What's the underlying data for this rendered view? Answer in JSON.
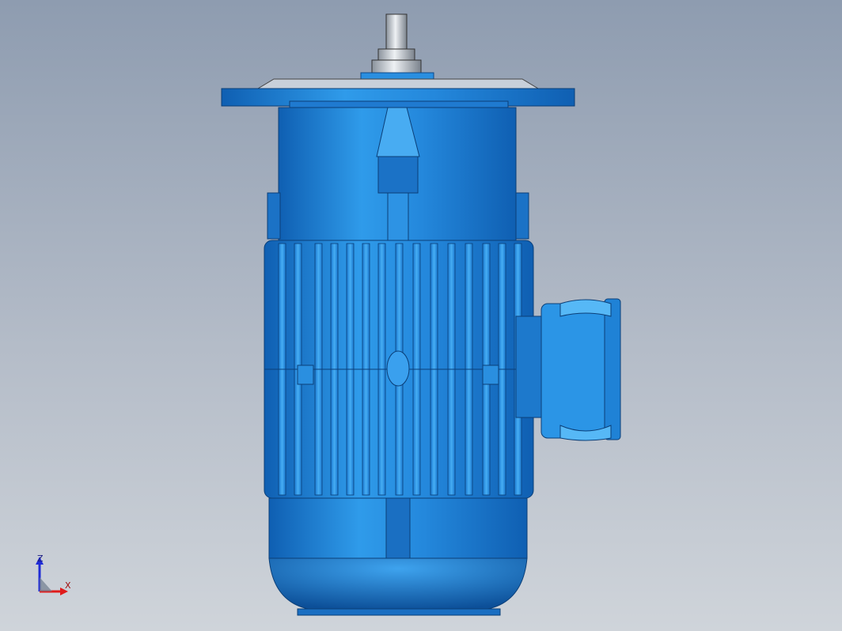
{
  "viewport": {
    "background_top": "#8e9cb0",
    "background_bottom": "#cfd4da"
  },
  "model": {
    "name": "electric-motor",
    "body_color": "#2a8fe0",
    "dark_color": "#0d5aa8",
    "light_color": "#4fb2f5",
    "shaft_color": "#c9cfd6"
  },
  "triad": {
    "z_label": "Z",
    "x_label": "X",
    "z_color": "#1f2bd6",
    "x_color": "#e01b1b"
  }
}
